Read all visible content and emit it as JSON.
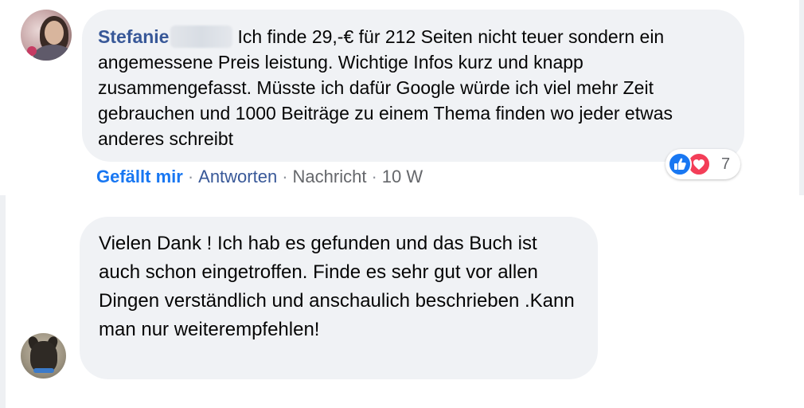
{
  "comment_1": {
    "author": "Stefanie",
    "text": "Ich finde 29,-€ für 212 Seiten nicht teuer sondern ein angemessene Preis leistung. Wichtige Infos kurz und knapp zusammengefasst. Müsste ich dafür Google würde ich viel mehr Zeit gebrauchen und 1000 Beiträge zu einem Thema finden wo jeder etwas anderes schreibt",
    "actions": {
      "like": "Gefällt mir",
      "reply": "Antworten",
      "message": "Nachricht",
      "time": "10 W",
      "separator": "·"
    },
    "reactions": {
      "icons": [
        "like-icon",
        "love-icon"
      ],
      "count": "7",
      "like_color": "#1877f2",
      "love_color": "#f33e58"
    }
  },
  "comment_2": {
    "text": "Vielen Dank ! Ich hab es gefunden und das Buch ist auch schon eingetroffen. Finde es sehr gut vor allen Dingen verständlich und anschaulich beschrieben .Kann man nur weiterempfehlen!"
  },
  "colors": {
    "bubble": "#f0f2f5",
    "author": "#385898",
    "action_link": "#1877f2",
    "meta": "#65676b"
  }
}
